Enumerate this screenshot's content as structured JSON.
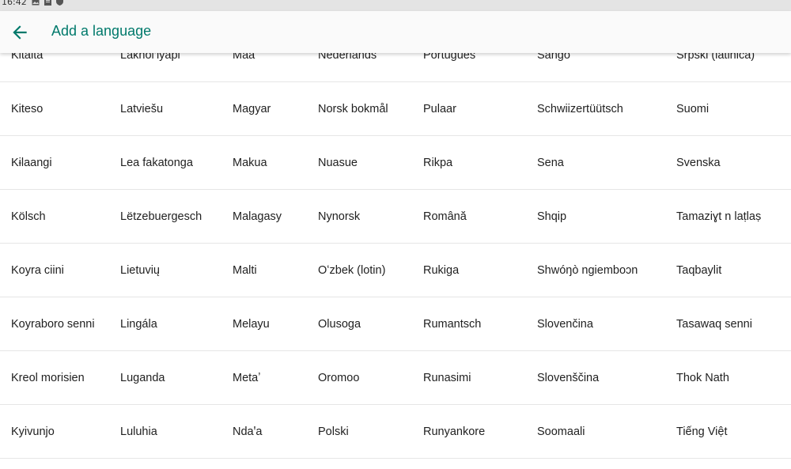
{
  "status_bar": {
    "time": "16:42",
    "icons": [
      "image-icon",
      "sd-card-icon",
      "shield-icon"
    ]
  },
  "app_bar": {
    "back_icon": "arrow-back-icon",
    "title": "Add a language",
    "accent_color": "#00796b"
  },
  "languages": [
    [
      "Kitaita",
      "Lakȟól’iyapi",
      "Maa",
      "Nederlands",
      "Português",
      "Sängö",
      "Srpski (latinica)"
    ],
    [
      "Kiteso",
      "Latviešu",
      "Magyar",
      "Norsk bokmål",
      "Pulaar",
      "Schwiizertüütsch",
      "Suomi"
    ],
    [
      "Kɨlaangi",
      "Lea fakatonga",
      "Makua",
      "Nuasue",
      "Rikpa",
      "Sena",
      "Svenska"
    ],
    [
      "Kölsch",
      "Lëtzebuergesch",
      "Malagasy",
      "Nynorsk",
      "Română",
      "Shqip",
      "Tamaziɣt n laṭlaṣ"
    ],
    [
      "Koyra ciini",
      "Lietuvių",
      "Malti",
      "Oʻzbek (lotin)",
      "Rukiga",
      "Shwóŋò ngiemboɔn",
      "Taqbaylit"
    ],
    [
      "Koyraboro senni",
      "Lingála",
      "Melayu",
      "Olusoga",
      "Rumantsch",
      "Slovenčina",
      "Tasawaq senni"
    ],
    [
      "Kreol morisien",
      "Luganda",
      "Metaʼ",
      "Oromoo",
      "Runasimi",
      "Slovenščina",
      "Thok Nath"
    ],
    [
      "Kyivunjo",
      "Luluhia",
      "Ndaꞌa",
      "Polski",
      "Runyankore",
      "Soomaali",
      "Tiếng Việt"
    ]
  ]
}
